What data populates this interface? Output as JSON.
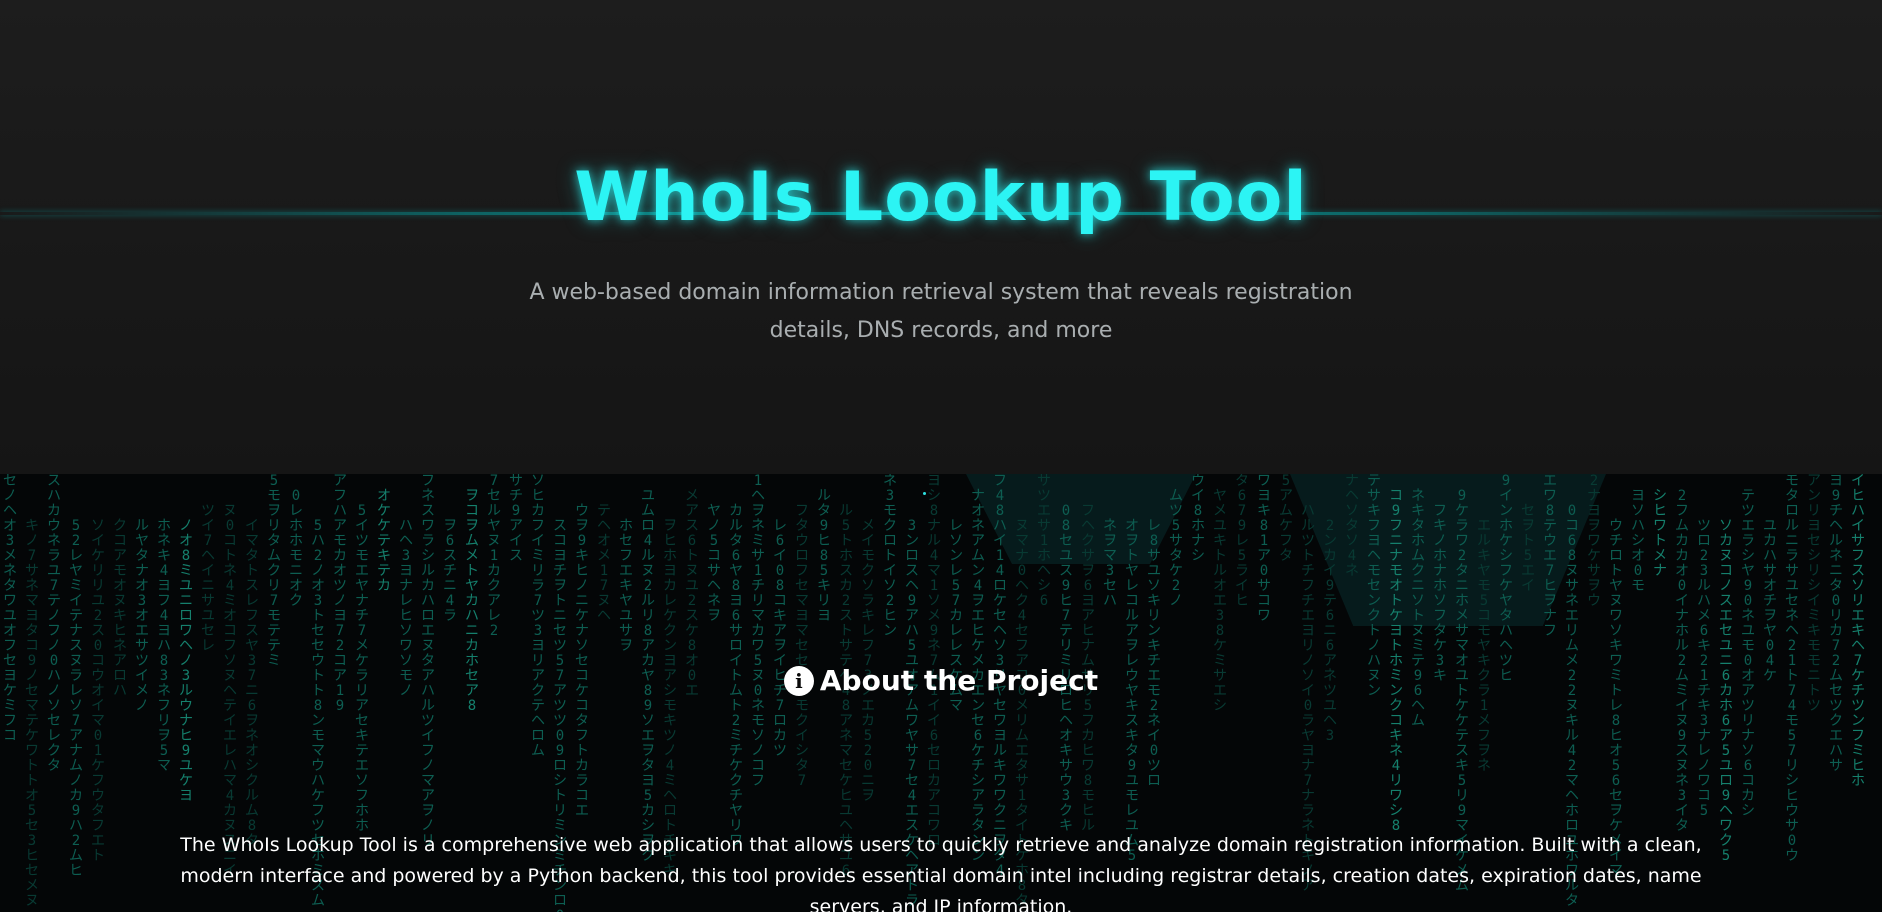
{
  "hero": {
    "title": "WhoIs Lookup Tool",
    "subtitle": "A web-based domain information retrieval system that reveals registration details, DNS records, and more"
  },
  "about": {
    "icon": "info-icon",
    "icon_glyph": "i",
    "title": "About the Project",
    "text": "The WhoIs Lookup Tool is a comprehensive web application that allows users to quickly retrieve and analyze domain registration information. Built with a clean, modern interface and powered by a Python backend, this tool provides essential domain intel including registrar details, creation dates, expiration dates, name servers, and IP information."
  },
  "colors": {
    "accent": "#2cf4f4",
    "hero_bg": "#1b1b1b",
    "matrix_green": "#0d5e52",
    "text": "#ffffff",
    "subtitle": "#a9aeb0"
  }
}
